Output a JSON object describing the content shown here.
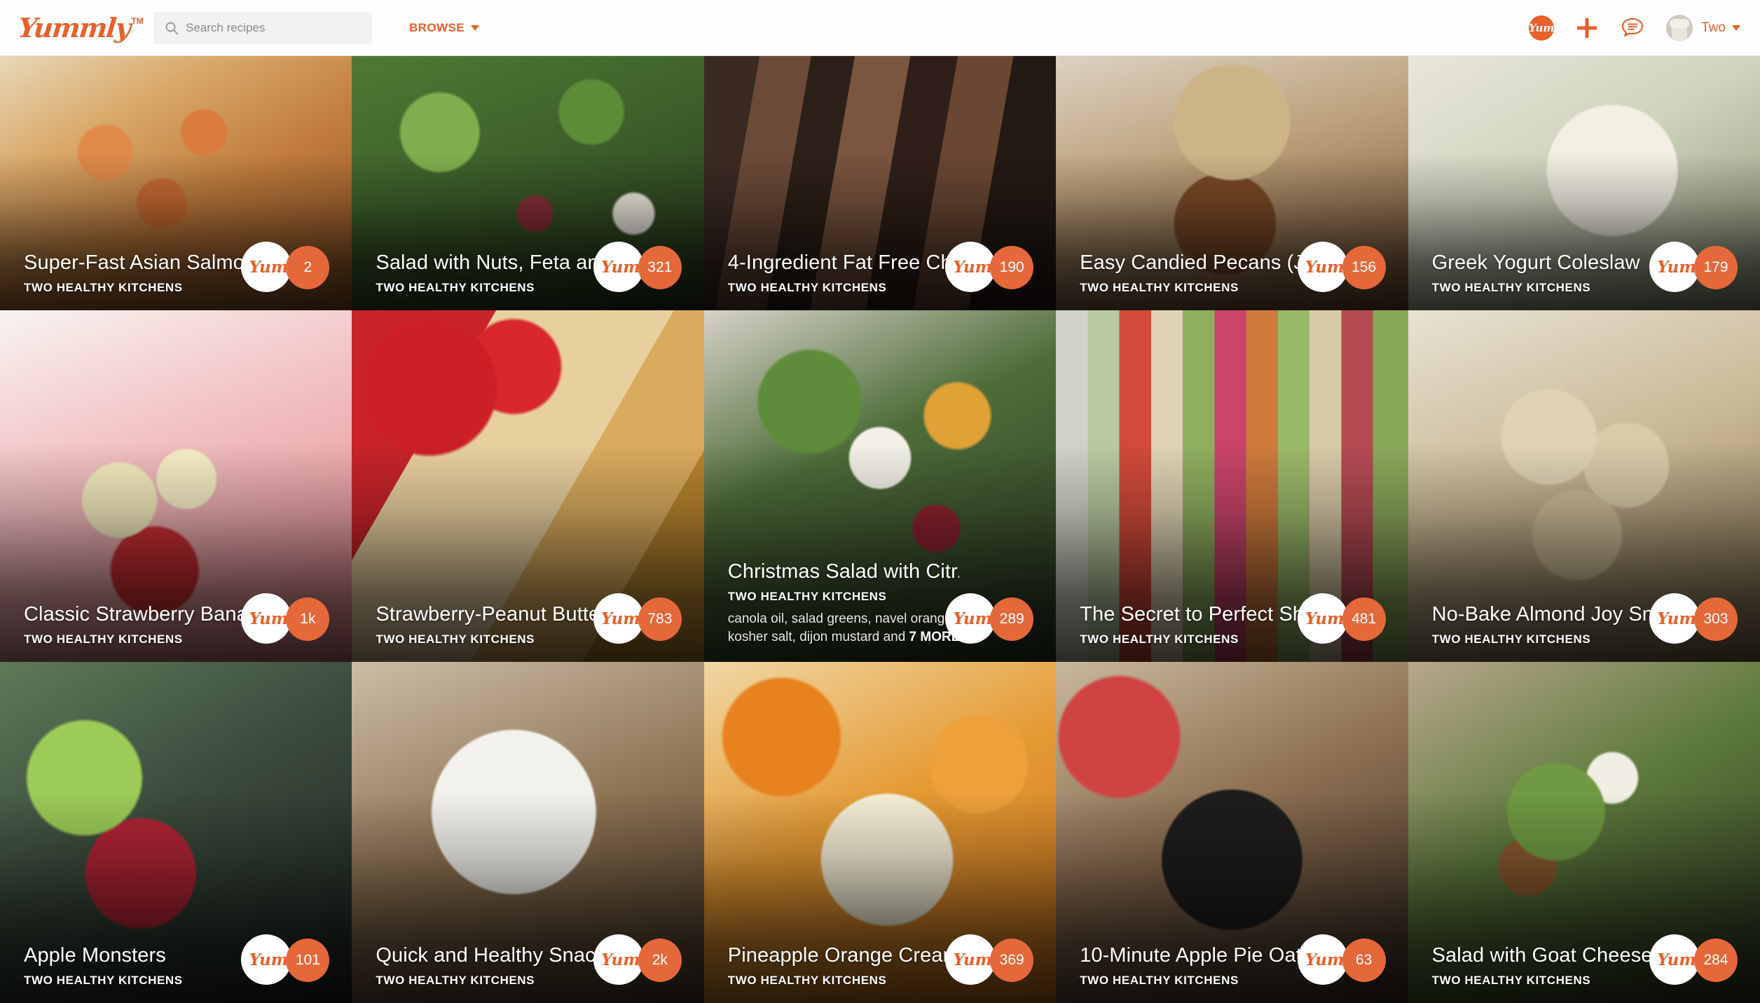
{
  "header": {
    "logo_text": "Yummly",
    "logo_tm": "TM",
    "search": {
      "placeholder": "Search recipes",
      "value": ""
    },
    "browse_label": "BROWSE",
    "icons": {
      "yum_label": "Yum",
      "add_label": "+",
      "chat_label": "chat"
    },
    "user_name": "Two"
  },
  "grid": {
    "source_label": "TWO HEALTHY KITCHENS",
    "cards": [
      {
        "title": "Super-Fast Asian Salmon ...",
        "source": "TWO HEALTHY KITCHENS",
        "yums": "2",
        "yum_label": "Yum",
        "ingredients": "",
        "more": ""
      },
      {
        "title": "Salad with Nuts, Feta and...",
        "source": "TWO HEALTHY KITCHENS",
        "yums": "321",
        "yum_label": "Yum",
        "ingredients": "",
        "more": ""
      },
      {
        "title": "4-Ingredient Fat Free Cho...",
        "source": "TWO HEALTHY KITCHENS",
        "yums": "190",
        "yum_label": "Yum",
        "ingredients": "",
        "more": ""
      },
      {
        "title": "Easy Candied Pecans (Ju...",
        "source": "TWO HEALTHY KITCHENS",
        "yums": "156",
        "yum_label": "Yum",
        "ingredients": "",
        "more": ""
      },
      {
        "title": "Greek Yogurt Coleslaw",
        "source": "TWO HEALTHY KITCHENS",
        "yums": "179",
        "yum_label": "Yum",
        "ingredients": "",
        "more": ""
      },
      {
        "title": "Classic Strawberry Banan...",
        "source": "TWO HEALTHY KITCHENS",
        "yums": "1k",
        "yum_label": "Yum",
        "ingredients": "",
        "more": ""
      },
      {
        "title": "Strawberry-Peanut Butter...",
        "source": "TWO HEALTHY KITCHENS",
        "yums": "783",
        "yum_label": "Yum",
        "ingredients": "",
        "more": ""
      },
      {
        "title": "Christmas Salad with Citr...",
        "source": "TWO HEALTHY KITCHENS",
        "yums": "289",
        "yum_label": "Yum",
        "ingredients": "canola oil, salad greens, navel oranges, kosher salt, dijon mustard and ",
        "more": "7 MORE"
      },
      {
        "title": "The Secret to Perfect Shi...",
        "source": "TWO HEALTHY KITCHENS",
        "yums": "481",
        "yum_label": "Yum",
        "ingredients": "",
        "more": ""
      },
      {
        "title": "No-Bake Almond Joy Sn...",
        "source": "TWO HEALTHY KITCHENS",
        "yums": "303",
        "yum_label": "Yum",
        "ingredients": "",
        "more": ""
      },
      {
        "title": "Apple Monsters",
        "source": "TWO HEALTHY KITCHENS",
        "yums": "101",
        "yum_label": "Yum",
        "ingredients": "",
        "more": ""
      },
      {
        "title": "Quick and Healthy Snack ...",
        "source": "TWO HEALTHY KITCHENS",
        "yums": "2k",
        "yum_label": "Yum",
        "ingredients": "",
        "more": ""
      },
      {
        "title": "Pineapple Orange Cream...",
        "source": "TWO HEALTHY KITCHENS",
        "yums": "369",
        "yum_label": "Yum",
        "ingredients": "",
        "more": ""
      },
      {
        "title": "10-Minute Apple Pie Oat...",
        "source": "TWO HEALTHY KITCHENS",
        "yums": "63",
        "yum_label": "Yum",
        "ingredients": "",
        "more": ""
      },
      {
        "title": "Salad with Goat Cheese, ...",
        "source": "TWO HEALTHY KITCHENS",
        "yums": "284",
        "yum_label": "Yum",
        "ingredients": "",
        "more": ""
      }
    ]
  },
  "colors": {
    "brand_orange": "#e8602c",
    "badge_orange": "#e5683a",
    "header_bg": "#fdfdfd"
  }
}
